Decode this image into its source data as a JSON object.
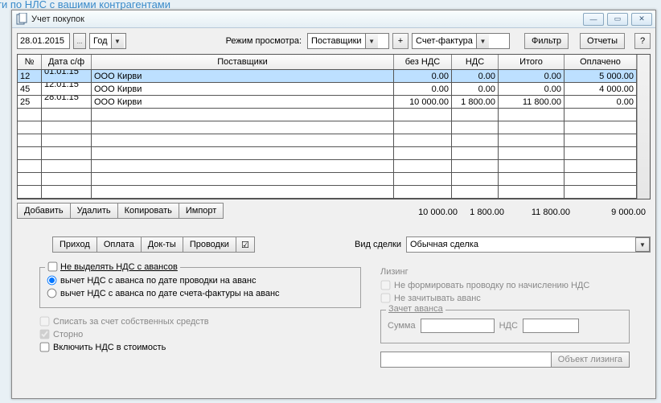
{
  "background_text": "ти по НЛС с вашими контрагентами",
  "window": {
    "title": "Учет покупок"
  },
  "toolbar": {
    "date": "28.01.2015",
    "period_combo": "Год",
    "view_mode_label": "Режим просмотра:",
    "view_mode_value": "Поставщики",
    "doc_combo": "Счет-фактура",
    "filter": "Фильтр",
    "reports": "Отчеты",
    "help": "?"
  },
  "grid": {
    "headers": [
      "№",
      "Дата с/ф",
      "Поставщики",
      "без НДС",
      "НДС",
      "Итого",
      "Оплачено"
    ],
    "rows": [
      {
        "no": "12",
        "date": "01.01.15 ...",
        "sup": "ООО Кирви",
        "b": "0.00",
        "n": "0.00",
        "t": "0.00",
        "p": "5 000.00",
        "sel": true
      },
      {
        "no": "45",
        "date": "12.01.15 ...",
        "sup": "ООО Кирви",
        "b": "0.00",
        "n": "0.00",
        "t": "0.00",
        "p": "4 000.00"
      },
      {
        "no": "25",
        "date": "28.01.15 ...",
        "sup": "ООО Кирви",
        "b": "10 000.00",
        "n": "1 800.00",
        "t": "11 800.00",
        "p": "0.00"
      }
    ],
    "totals": {
      "b": "10 000.00",
      "n": "1 800.00",
      "t": "11 800.00",
      "p": "9 000.00"
    }
  },
  "actions": {
    "add": "Добавить",
    "del": "Удалить",
    "copy": "Копировать",
    "imp": "Импорт"
  },
  "tabs": {
    "prihod": "Приход",
    "oplata": "Оплата",
    "docs": "Док-ты",
    "prov": "Проводки",
    "chk": "☑"
  },
  "deal": {
    "label": "Вид сделки",
    "value": "Обычная сделка"
  },
  "advances": {
    "legend": "Не выделять НДС с авансов",
    "r1": "вычет НДС с аванса по дате проводки на аванс",
    "r2": "вычет НДС с аванса по дате счета-фактуры на аванс"
  },
  "checks": {
    "own": "Списать за счет собственных средств",
    "storno": "Сторно",
    "incl": "Включить НДС в стоимость"
  },
  "leasing": {
    "title": "Лизинг",
    "c1": "Не формировать проводку по начислению НДС",
    "c2": "Не зачитывать аванс",
    "zachet": "Зачет аванса",
    "sum": "Сумма",
    "nds": "НДС",
    "obj": "Объект лизинга"
  }
}
